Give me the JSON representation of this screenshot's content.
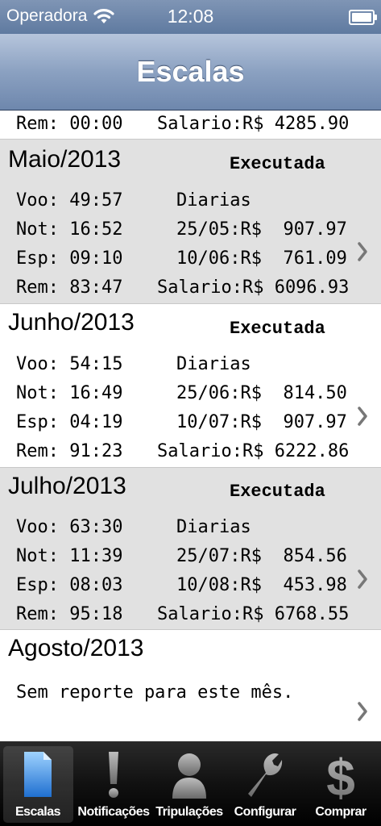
{
  "status_bar": {
    "carrier": "Operadora",
    "time": "12:08"
  },
  "nav": {
    "title": "Escalas"
  },
  "partial_row": {
    "left": "Rem: 00:00",
    "right": "Salario:R$ 4285.90"
  },
  "months": [
    {
      "month": "Maio/2013",
      "status": "Executada",
      "rows": [
        {
          "left": "Voo: 49:57",
          "right": "Diarias"
        },
        {
          "left": "Not: 16:52",
          "right": "25/05:R$  907.97"
        },
        {
          "left": "Esp: 09:10",
          "right": "10/06:R$  761.09"
        },
        {
          "left": "Rem: 83:47",
          "right": "Salario:R$ 6096.93"
        }
      ]
    },
    {
      "month": "Junho/2013",
      "status": "Executada",
      "rows": [
        {
          "left": "Voo: 54:15",
          "right": "Diarias"
        },
        {
          "left": "Not: 16:49",
          "right": "25/06:R$  814.50"
        },
        {
          "left": "Esp: 04:19",
          "right": "10/07:R$  907.97"
        },
        {
          "left": "Rem: 91:23",
          "right": "Salario:R$ 6222.86"
        }
      ]
    },
    {
      "month": "Julho/2013",
      "status": "Executada",
      "rows": [
        {
          "left": "Voo: 63:30",
          "right": "Diarias"
        },
        {
          "left": "Not: 11:39",
          "right": "25/07:R$  854.56"
        },
        {
          "left": "Esp: 08:03",
          "right": "10/08:R$  453.98"
        },
        {
          "left": "Rem: 95:18",
          "right": "Salario:R$ 6768.55"
        }
      ]
    },
    {
      "month": "Agosto/2013",
      "message": "Sem reporte para este mês."
    }
  ],
  "tabs": [
    {
      "label": "Escalas",
      "icon": "document-icon",
      "selected": true
    },
    {
      "label": "Notificações",
      "icon": "exclamation-icon"
    },
    {
      "label": "Tripulações",
      "icon": "person-icon"
    },
    {
      "label": "Configurar",
      "icon": "wrench-icon"
    },
    {
      "label": "Comprar",
      "icon": "dollar-icon"
    }
  ],
  "colors": {
    "nav_blue": "#7f95b5",
    "cell_gray": "#e1e1e1",
    "tab_bar": "#111111",
    "tab_selected_icon": "#2f8fe0"
  }
}
